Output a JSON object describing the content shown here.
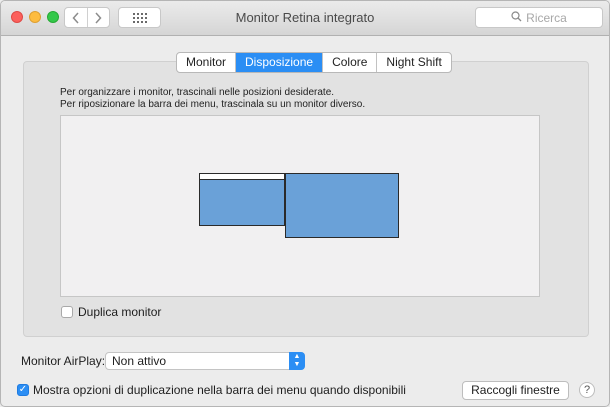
{
  "window": {
    "title": "Monitor Retina integrato"
  },
  "toolbar": {
    "back_icon": "chevron-left-icon",
    "forward_icon": "chevron-right-icon",
    "grid_icon": "grid-icon",
    "search_icon": "search-icon",
    "search_placeholder": "Ricerca"
  },
  "tabs": [
    {
      "label": "Monitor",
      "active": false
    },
    {
      "label": "Disposizione",
      "active": true
    },
    {
      "label": "Colore",
      "active": false
    },
    {
      "label": "Night Shift",
      "active": false
    }
  ],
  "instructions": {
    "line1": "Per organizzare i monitor, trascinali nelle posizioni desiderate.",
    "line2": "Per riposizionare la barra dei menu, trascinala su un monitor diverso."
  },
  "mirror_displays": {
    "label": "Duplica monitor",
    "checked": false
  },
  "airplay": {
    "label": "Monitor AirPlay:",
    "value": "Non attivo"
  },
  "show_mirroring": {
    "label": "Mostra opzioni di duplicazione nella barra dei menu quando disponibili",
    "checked": true
  },
  "gather_button": {
    "label": "Raccogli finestre"
  },
  "help": {
    "label": "?"
  },
  "colors": {
    "accent": "#2b8ef4",
    "monitor": "#6aa1d8"
  }
}
